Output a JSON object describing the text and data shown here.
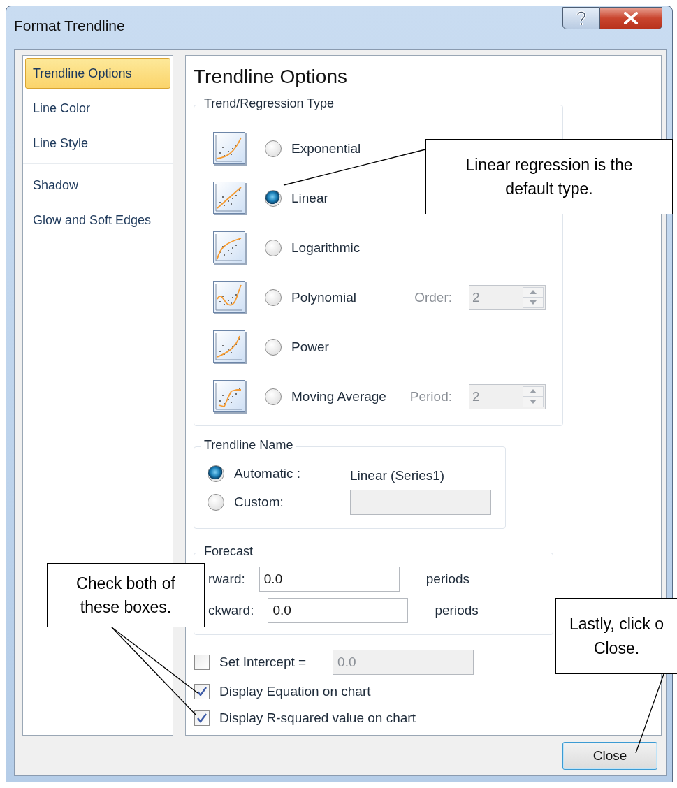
{
  "window": {
    "title": "Format Trendline"
  },
  "sidebar": {
    "items": [
      {
        "label": "Trendline Options",
        "selected": true,
        "separator_before": false
      },
      {
        "label": "Line Color",
        "selected": false,
        "separator_before": false
      },
      {
        "label": "Line Style",
        "selected": false,
        "separator_before": false
      },
      {
        "label": "Shadow",
        "selected": false,
        "separator_before": true
      },
      {
        "label": "Glow and Soft Edges",
        "selected": false,
        "separator_before": false
      }
    ]
  },
  "panel": {
    "heading": "Trendline Options",
    "regression": {
      "title": "Trend/Regression Type",
      "options": [
        {
          "kind": "exponential",
          "label": "Exponential",
          "selected": false
        },
        {
          "kind": "linear",
          "label": "Linear",
          "selected": true
        },
        {
          "kind": "logarithmic",
          "label": "Logarithmic",
          "selected": false
        },
        {
          "kind": "polynomial",
          "label": "Polynomial",
          "selected": false,
          "param": {
            "label": "Order:",
            "value": "2",
            "disabled": true
          }
        },
        {
          "kind": "power",
          "label": "Power",
          "selected": false
        },
        {
          "kind": "moving_average",
          "label": "Moving Average",
          "selected": false,
          "param": {
            "label": "Period:",
            "value": "2",
            "disabled": true
          }
        }
      ]
    },
    "name": {
      "title": "Trendline Name",
      "options": [
        {
          "kind": "automatic",
          "label": "Automatic :",
          "selected": true,
          "value": "Linear (Series1)"
        },
        {
          "kind": "custom",
          "label": "Custom:",
          "selected": false
        }
      ]
    },
    "forecast": {
      "title": "Forecast",
      "rows": [
        {
          "label": "rward:",
          "value": "0.0",
          "unit": "periods"
        },
        {
          "label": "ckward:",
          "value": "0.0",
          "unit": "periods"
        }
      ]
    },
    "checks": [
      {
        "kind": "intercept",
        "label": "Set Intercept =",
        "checked": false,
        "value": "0.0"
      },
      {
        "kind": "plain",
        "label": "Display Equation on chart",
        "checked": true
      },
      {
        "kind": "plain",
        "label": "Display R-squared value on chart",
        "checked": true
      }
    ]
  },
  "buttons": [
    {
      "label": "Close"
    }
  ],
  "callouts": [
    {
      "lines": [
        "Linear regression is the",
        "default type."
      ]
    },
    {
      "lines": [
        "Check both of",
        "these boxes."
      ]
    },
    {
      "lines": [
        "Lastly, click o",
        "Close."
      ]
    }
  ]
}
